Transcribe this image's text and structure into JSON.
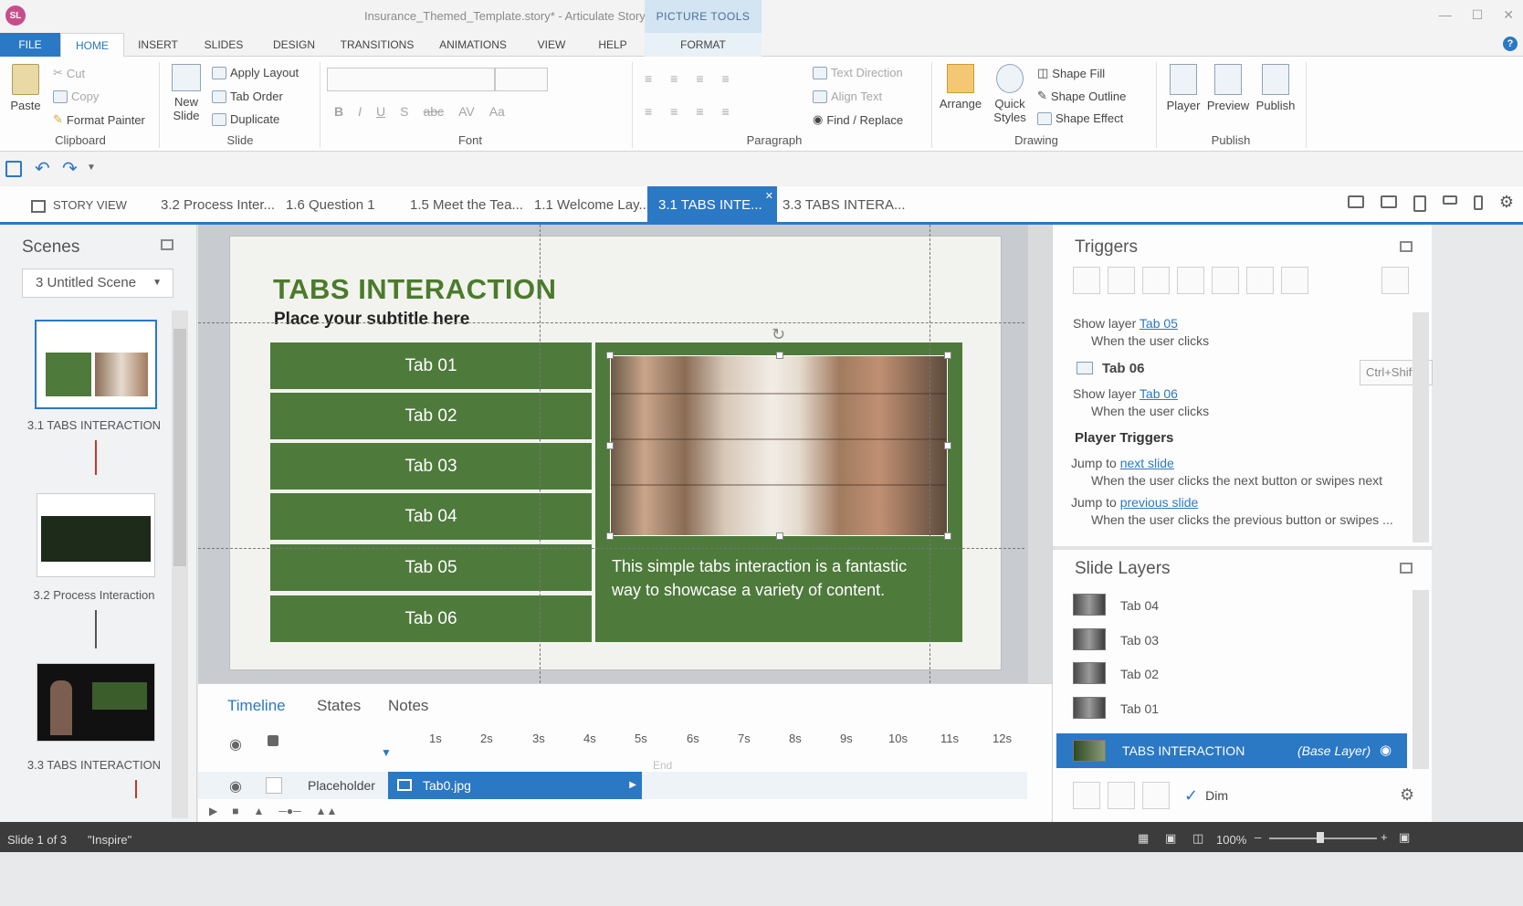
{
  "titlebar": {
    "app_icon": "SL",
    "title": "Insurance_Themed_Template.story* - Articulate Storyline",
    "context_tab": "PICTURE TOOLS"
  },
  "ribbon_tabs": [
    "FILE",
    "HOME",
    "INSERT",
    "SLIDES",
    "DESIGN",
    "TRANSITIONS",
    "ANIMATIONS",
    "VIEW",
    "HELP",
    "FORMAT"
  ],
  "ribbon": {
    "clipboard": {
      "paste": "Paste",
      "cut": "Cut",
      "copy": "Copy",
      "format_painter": "Format Painter",
      "label": "Clipboard"
    },
    "slide": {
      "new_slide": "New Slide",
      "apply_layout": "Apply Layout",
      "tab_order": "Tab Order",
      "duplicate": "Duplicate",
      "label": "Slide"
    },
    "font": {
      "label": "Font"
    },
    "paragraph": {
      "text_direction": "Text Direction",
      "align_text": "Align Text",
      "find_replace": "Find / Replace",
      "label": "Paragraph"
    },
    "drawing": {
      "arrange": "Arrange",
      "quick_styles": "Quick Styles",
      "shape_fill": "Shape Fill",
      "shape_outline": "Shape Outline",
      "shape_effect": "Shape Effect",
      "label": "Drawing"
    },
    "publish": {
      "player": "Player",
      "preview": "Preview",
      "publish": "Publish",
      "label": "Publish"
    }
  },
  "doc_tabs": {
    "story_view": "STORY VIEW",
    "tabs": [
      "3.2 Process Inter...",
      "1.6 Question 1",
      "1.5 Meet the Tea...",
      "1.1 Welcome Lay...",
      "3.1 TABS INTE...",
      "3.3 TABS INTERA..."
    ],
    "active_index": 4
  },
  "scenes": {
    "title": "Scenes",
    "selected_scene": "3 Untitled Scene",
    "slides": [
      "3.1 TABS INTERACTION",
      "3.2 Process Interaction",
      "3.3 TABS INTERACTION"
    ]
  },
  "slide": {
    "title": "TABS INTERACTION",
    "subtitle": "Place your subtitle here",
    "tabs": [
      "Tab 01",
      "Tab 02",
      "Tab 03",
      "Tab 04",
      "Tab 05",
      "Tab 06"
    ],
    "content": "This simple tabs interaction is a fantastic way to showcase a variety of content."
  },
  "timeline": {
    "tabs": [
      "Timeline",
      "States",
      "Notes"
    ],
    "ticks": [
      "1s",
      "2s",
      "3s",
      "4s",
      "5s",
      "6s",
      "7s",
      "8s",
      "9s",
      "10s",
      "11s",
      "12s"
    ],
    "row_name": "Placeholder",
    "row_object": "Tab0.jpg",
    "end_label": "End"
  },
  "triggers": {
    "title": "Triggers",
    "show_layer_1": {
      "prefix": "Show layer",
      "target": "Tab 05",
      "condition": "When the user clicks"
    },
    "tab06_name": "Tab 06",
    "show_layer_2": {
      "prefix": "Show layer",
      "target": "Tab 06",
      "condition": "When the user clicks"
    },
    "shortcut_hint": "Ctrl+Shift+",
    "player_triggers": "Player Triggers",
    "jump_next": {
      "prefix": "Jump to",
      "target": "next slide",
      "condition": "When the user clicks the next button or swipes next"
    },
    "jump_prev": {
      "prefix": "Jump to",
      "target": "previous slide",
      "condition": "When the user clicks the previous button or swipes ..."
    }
  },
  "slide_layers": {
    "title": "Slide Layers",
    "layers": [
      "Tab 04",
      "Tab 03",
      "Tab 02",
      "Tab 01"
    ],
    "base_layer_name": "TABS INTERACTION",
    "base_layer_tag": "(Base Layer)",
    "dim_label": "Dim"
  },
  "status": {
    "slide_count": "Slide 1 of 3",
    "theme": "\"Inspire\"",
    "zoom": "100%"
  },
  "colors": {
    "accent": "#2b78c5",
    "slide_green": "#4e7a3c",
    "title_green": "#4b7a2c"
  }
}
